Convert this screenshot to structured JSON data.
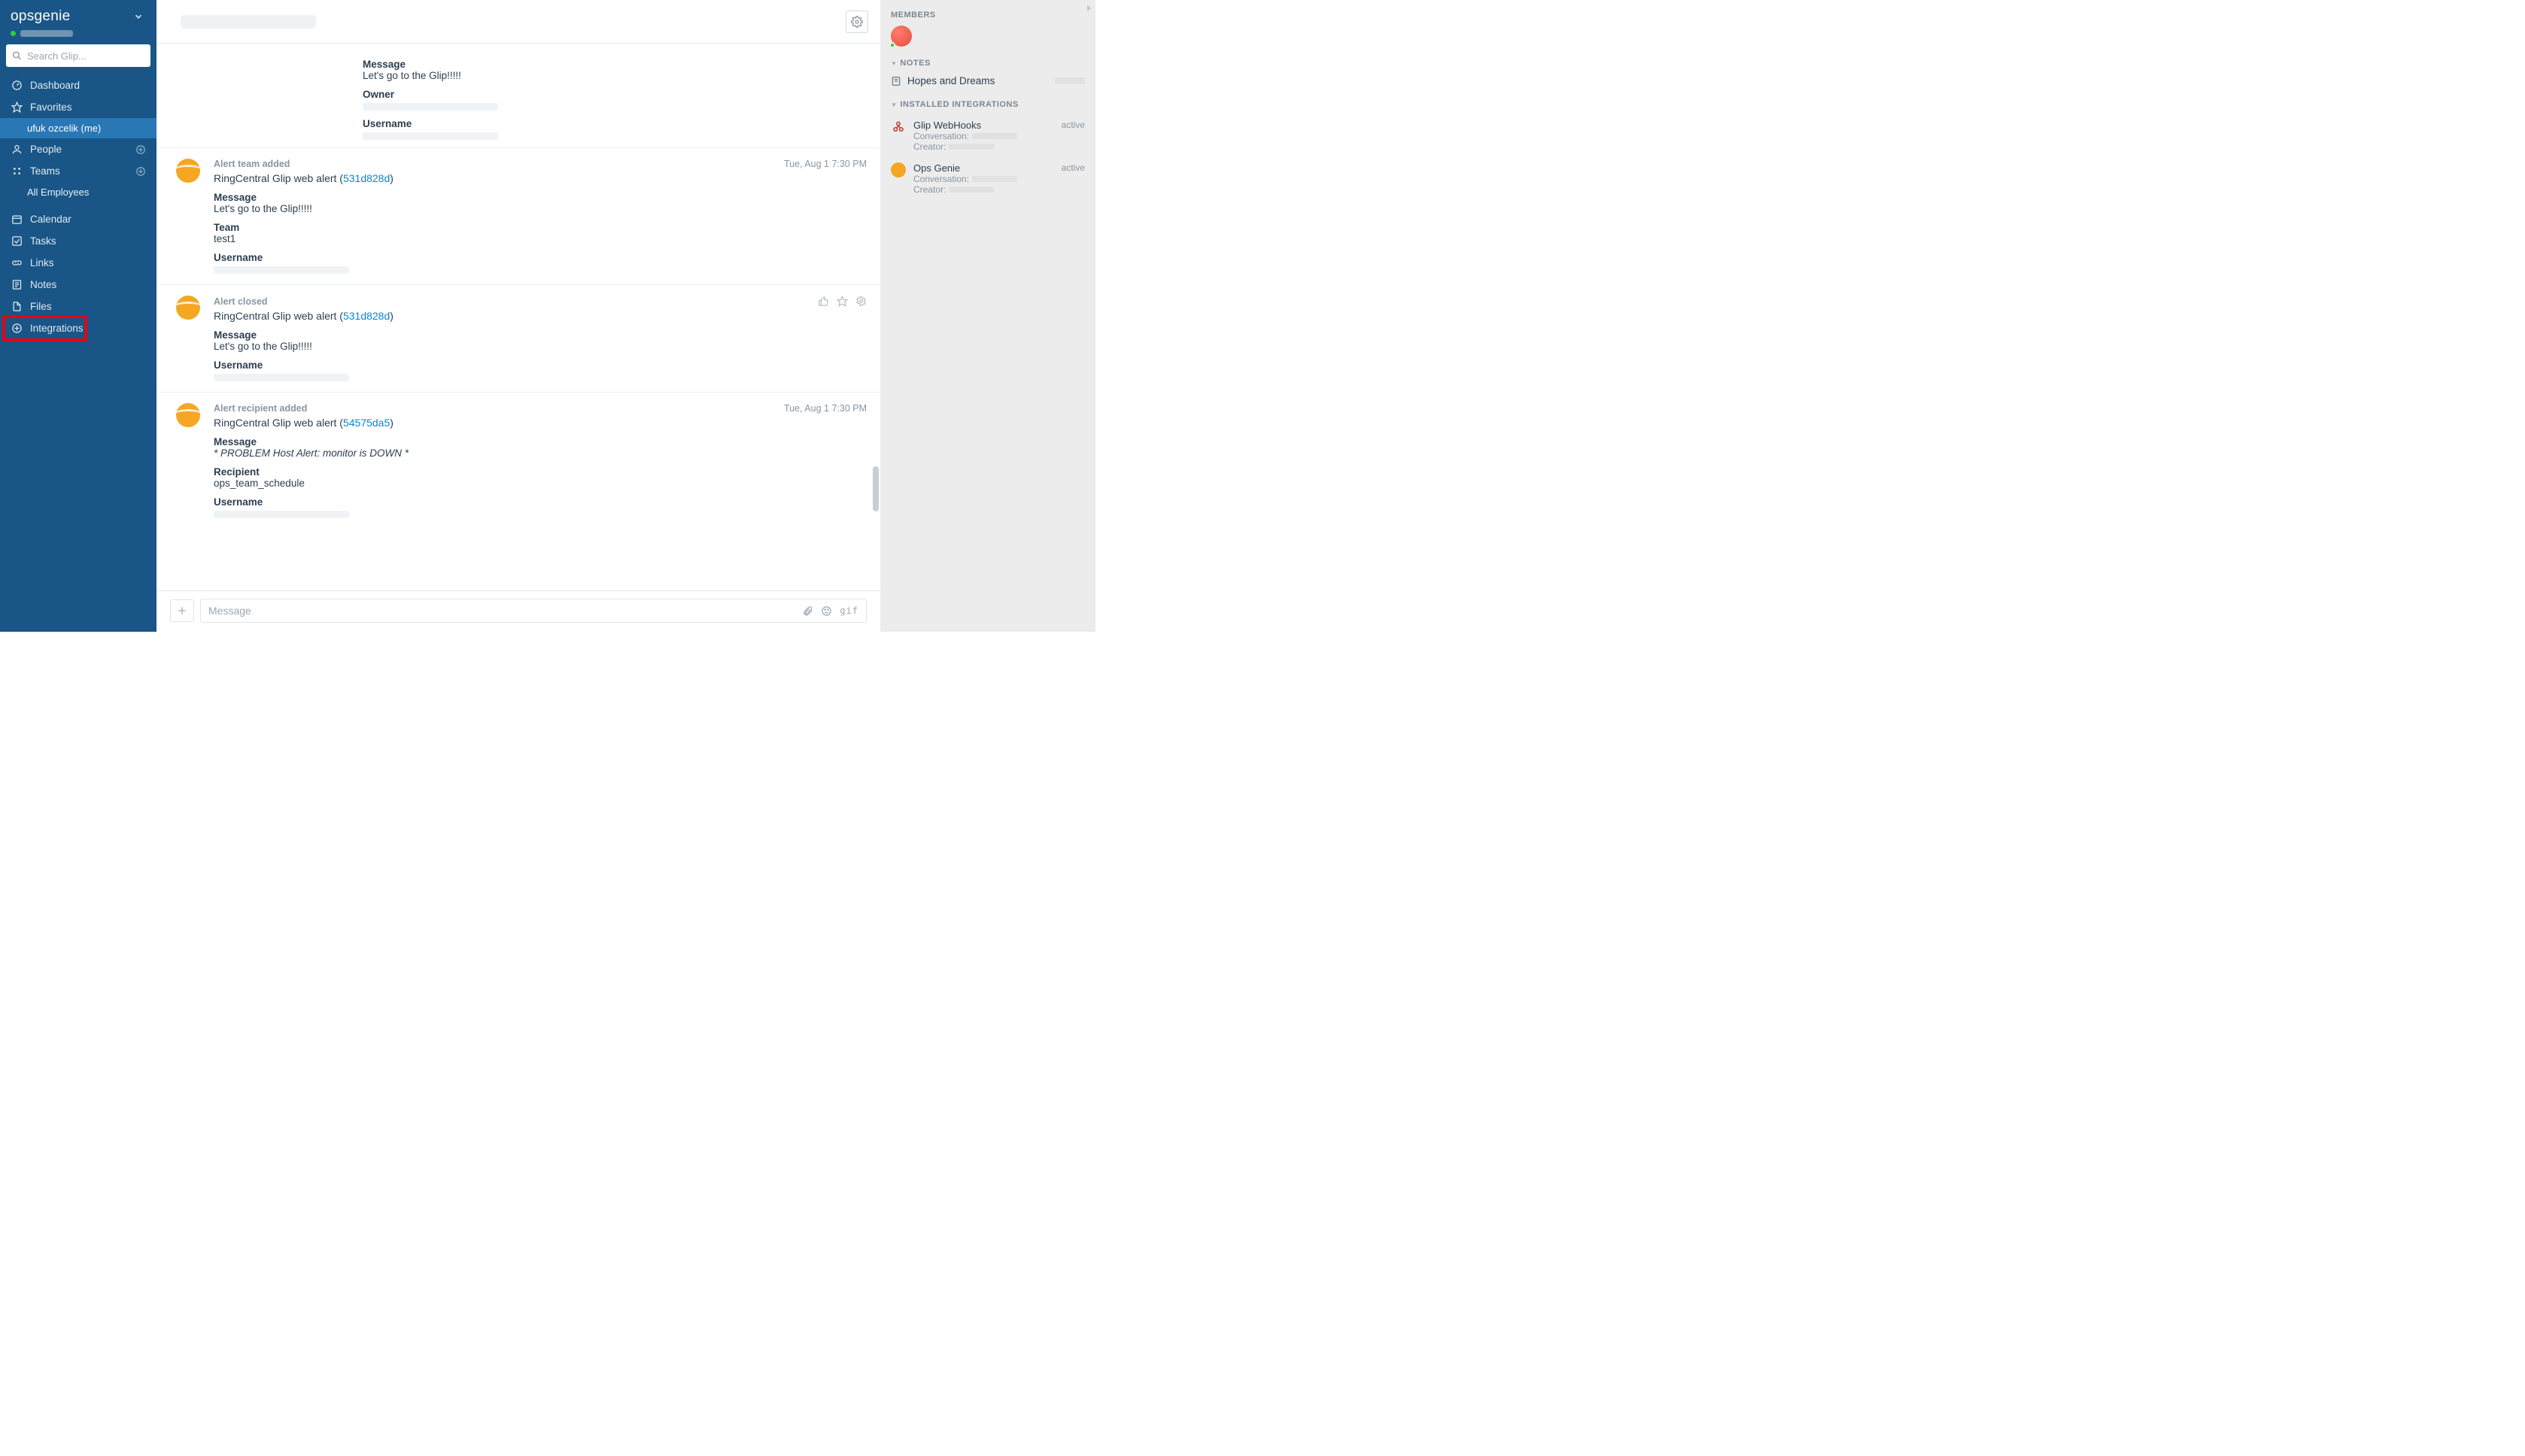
{
  "sidebar": {
    "app_name": "opsgenie",
    "search_placeholder": "Search Glip...",
    "nav": {
      "dashboard": "Dashboard",
      "favorites": "Favorites",
      "favorite_me": "ufuk ozcelik (me)",
      "people": "People",
      "teams": "Teams",
      "teams_sub_all": "All Employees",
      "calendar": "Calendar",
      "tasks": "Tasks",
      "links": "Links",
      "notes": "Notes",
      "files": "Files",
      "integrations": "Integrations"
    }
  },
  "partial_msg": {
    "message_label": "Message",
    "message_value": "Let's go to the Glip!!!!!",
    "owner_label": "Owner",
    "username_label": "Username"
  },
  "messages": [
    {
      "kind": "Alert team added",
      "time": "Tue, Aug 1 7:30 PM",
      "line_prefix": "RingCentral Glip web alert (",
      "line_link": "531d828d",
      "line_suffix": ")",
      "fields": [
        {
          "label": "Message",
          "value": "Let's go to the Glip!!!!!"
        },
        {
          "label": "Team",
          "value": "test1"
        },
        {
          "label": "Username",
          "redacted": true
        }
      ]
    },
    {
      "kind": "Alert closed",
      "time_hidden": true,
      "show_actions": true,
      "line_prefix": "RingCentral Glip web alert (",
      "line_link": "531d828d",
      "line_suffix": ")",
      "fields": [
        {
          "label": "Message",
          "value": "Let's go to the Glip!!!!!"
        },
        {
          "label": "Username",
          "redacted": true
        }
      ]
    },
    {
      "kind": "Alert recipient added",
      "time": "Tue, Aug 1 7:30 PM",
      "line_prefix": "RingCentral Glip web alert (",
      "line_link": "54575da5",
      "line_suffix": ")",
      "fields": [
        {
          "label": "Message",
          "value": "* PROBLEM Host Alert: monitor is DOWN *",
          "italic": true
        },
        {
          "label": "Recipient",
          "value": "ops_team_schedule"
        },
        {
          "label": "Username",
          "redacted": true
        }
      ]
    }
  ],
  "compose": {
    "placeholder": "Message"
  },
  "right": {
    "members_label": "MEMBERS",
    "notes_label": "NOTES",
    "note_item": "Hopes and Dreams",
    "integrations_label": "INSTALLED INTEGRATIONS",
    "ints": [
      {
        "name": "Glip WebHooks",
        "status": "active",
        "conv_label": "Conversation:",
        "creator_label": "Creator:"
      },
      {
        "name": "Ops Genie",
        "status": "active",
        "conv_label": "Conversation:",
        "creator_label": "Creator:"
      }
    ]
  },
  "gif_label": "gif"
}
